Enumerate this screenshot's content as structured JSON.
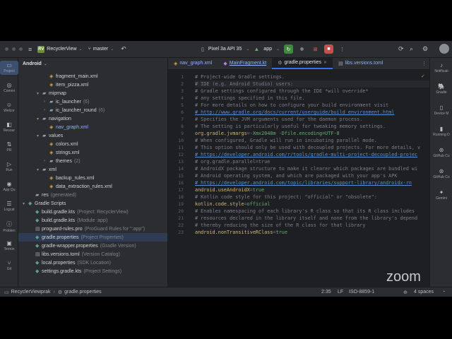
{
  "titlebar": {
    "project_badge": "RV",
    "project_name": "RecyclerView",
    "branch": "master",
    "device": "Pixel 3a API 35",
    "run_config": "app"
  },
  "left_strip": [
    "Project",
    "Commi",
    "Welcor",
    "Resour",
    "PR",
    "Run",
    "App Qu",
    "Logcat",
    "Problen",
    "Termin",
    "Git"
  ],
  "project_panel": {
    "header": "Android",
    "rows": [
      {
        "indent": 3,
        "arrow": "",
        "icon": "xml",
        "label": "fragment_main.xml",
        "hint": ""
      },
      {
        "indent": 3,
        "arrow": "",
        "icon": "xml",
        "label": "item_pizza.xml",
        "hint": ""
      },
      {
        "indent": 2,
        "arrow": "▾",
        "icon": "folder",
        "label": "mipmap",
        "hint": ""
      },
      {
        "indent": 3,
        "arrow": "›",
        "icon": "folder",
        "label": "ic_launcher",
        "hint": "(6)"
      },
      {
        "indent": 3,
        "arrow": "›",
        "icon": "folder",
        "label": "ic_launcher_round",
        "hint": "(6)"
      },
      {
        "indent": 2,
        "arrow": "▾",
        "icon": "folder",
        "label": "navigation",
        "hint": ""
      },
      {
        "indent": 3,
        "arrow": "",
        "icon": "xml",
        "label": "nav_graph.xml",
        "hint": "",
        "link": true
      },
      {
        "indent": 2,
        "arrow": "▾",
        "icon": "folder",
        "label": "values",
        "hint": ""
      },
      {
        "indent": 3,
        "arrow": "",
        "icon": "xml",
        "label": "colors.xml",
        "hint": ""
      },
      {
        "indent": 3,
        "arrow": "",
        "icon": "xml",
        "label": "strings.xml",
        "hint": ""
      },
      {
        "indent": 3,
        "arrow": "›",
        "icon": "folder",
        "label": "themes",
        "hint": "(2)"
      },
      {
        "indent": 2,
        "arrow": "▾",
        "icon": "folder",
        "label": "xml",
        "hint": ""
      },
      {
        "indent": 3,
        "arrow": "",
        "icon": "xml",
        "label": "backup_rules.xml",
        "hint": ""
      },
      {
        "indent": 3,
        "arrow": "",
        "icon": "xml",
        "label": "data_extraction_rules.xml",
        "hint": ""
      },
      {
        "indent": 1,
        "arrow": "",
        "icon": "folder",
        "label": "res",
        "hint": "(generated)"
      },
      {
        "indent": 0,
        "arrow": "▾",
        "icon": "gradle",
        "label": "Gradle Scripts",
        "hint": ""
      },
      {
        "indent": 1,
        "arrow": "",
        "icon": "gradle",
        "label": "build.gradle.kts",
        "hint": "(Project: RecyclerView)"
      },
      {
        "indent": 1,
        "arrow": "",
        "icon": "gradle",
        "label": "build.gradle.kts",
        "hint": "(Module :app)"
      },
      {
        "indent": 1,
        "arrow": "",
        "icon": "file",
        "label": "proguard-rules.pro",
        "hint": "(ProGuard Rules for \":app\")"
      },
      {
        "indent": 1,
        "arrow": "",
        "icon": "gradle",
        "label": "gradle.properties",
        "hint": "(Project Properties)",
        "selected": true
      },
      {
        "indent": 1,
        "arrow": "",
        "icon": "gradle",
        "label": "gradle-wrapper.properties",
        "hint": "(Gradle Version)"
      },
      {
        "indent": 1,
        "arrow": "",
        "icon": "file",
        "label": "libs.versions.toml",
        "hint": "(Version Catalog)"
      },
      {
        "indent": 1,
        "arrow": "",
        "icon": "gradle",
        "label": "local.properties",
        "hint": "(SDK Location)"
      },
      {
        "indent": 1,
        "arrow": "",
        "icon": "gradle",
        "label": "settings.gradle.kts",
        "hint": "(Project Settings)"
      }
    ]
  },
  "tabs": [
    {
      "label": "nav_graph.xml",
      "active": false
    },
    {
      "label": "MainFragment.kt",
      "active": false
    },
    {
      "label": "gradle.properties",
      "active": true
    },
    {
      "label": "libs.versions.toml",
      "active": false
    }
  ],
  "code_lines": [
    {
      "n": "1",
      "t": "# Project-wide Gradle settings.",
      "k": "cm"
    },
    {
      "n": "2",
      "t": "# IDE (e.g. Android Studio) users:",
      "k": "cm",
      "hl": true
    },
    {
      "n": "3",
      "t": "# Gradle settings configured through the IDE *will override*",
      "k": "cm"
    },
    {
      "n": "4",
      "t": "# any settings specified in this file.",
      "k": "cm"
    },
    {
      "n": "5",
      "t": "# For more details on how to configure your build environment visit",
      "k": "cm"
    },
    {
      "n": "6",
      "t": "# http://www.gradle.org/docs/current/userguide/build_environment.html",
      "k": "link"
    },
    {
      "n": "7",
      "t": "# Specifies the JVM arguments used for the daemon process.",
      "k": "cm"
    },
    {
      "n": "8",
      "t": "# The setting is particularly useful for tweaking memory settings.",
      "k": "cm"
    },
    {
      "n": "9",
      "key": "org.gradle.jvmargs",
      "val": "-Xmx2048m -Dfile.encoding=UTF-8",
      "k": "kv"
    },
    {
      "n": "10",
      "t": "# When configured, Gradle will run in incubating parallel mode.",
      "k": "cm"
    },
    {
      "n": "11",
      "t": "# This option should only be used with decoupled projects. For more details, v",
      "k": "cm"
    },
    {
      "n": "12",
      "t": "# https://developer.android.com/r/tools/gradle-multi-project-decoupled-projec",
      "k": "link"
    },
    {
      "n": "13",
      "t": "# org.gradle.parallel=true",
      "k": "cm"
    },
    {
      "n": "14",
      "t": "# AndroidX package structure to make it clearer which packages are bundled wi",
      "k": "cm"
    },
    {
      "n": "15",
      "t": "# Android operating system, and which are packaged with your app's APK",
      "k": "cm"
    },
    {
      "n": "16",
      "t": "# https://developer.android.com/topic/libraries/support-library/androidx-rn",
      "k": "link"
    },
    {
      "n": "17",
      "key": "android.useAndroidX",
      "val": "true",
      "k": "kv"
    },
    {
      "n": "18",
      "t": "# Kotlin code style for this project: \"official\" or \"obsolete\":",
      "k": "cm"
    },
    {
      "n": "19",
      "key": "kotlin.code.style",
      "val": "official",
      "k": "kv"
    },
    {
      "n": "20",
      "t": "# Enables namespacing of each library's R class so that its R class includes",
      "k": "cm"
    },
    {
      "n": "21",
      "t": "# resources declared in the library itself and none from the library's depend",
      "k": "cm"
    },
    {
      "n": "22",
      "t": "# thereby reducing the size of the R class for that library",
      "k": "cm"
    },
    {
      "n": "23",
      "key": "android.nonTransitiveRClass",
      "val": "true",
      "k": "kv"
    }
  ],
  "right_strip": [
    "Notificati",
    "Gradle",
    "Device M",
    "Running D",
    "GitHub Co",
    "GitHub Co",
    "Gemini"
  ],
  "statusbar": {
    "breadcrumb_project": "RecyclerViewprak",
    "breadcrumb_file": "gradle.properties",
    "position": "2:35",
    "line_sep": "LF",
    "encoding": "ISO-8859-1",
    "indent": "4 spaces"
  },
  "overlay": {
    "zoom_logo": "zoom"
  }
}
